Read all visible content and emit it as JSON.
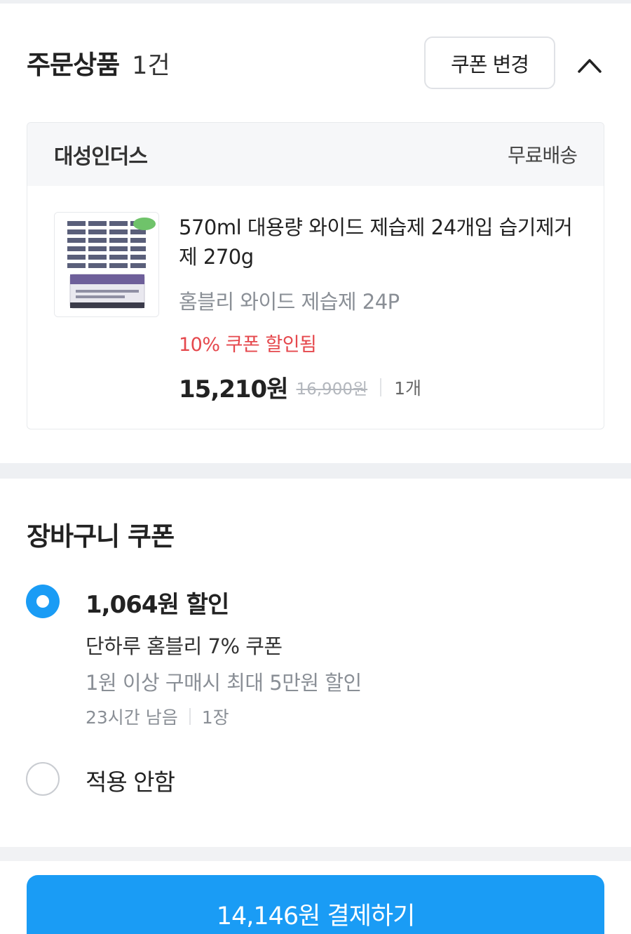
{
  "order": {
    "title": "주문상품",
    "count": "1건",
    "coupon_change_label": "쿠폰 변경",
    "collapse_icon": "chevron-up-icon"
  },
  "seller": {
    "name": "대성인더스",
    "shipping": "무료배송"
  },
  "product": {
    "name": "570ml 대용량 와이드 제습제 24개입 습기제거제 270g",
    "option": "홈블리 와이드 제습제 24P",
    "coupon_note": "10% 쿠폰 할인됨",
    "price": "15,210원",
    "original_price": "16,900원",
    "quantity": "1개",
    "thumbnail_badge": "LOHAS"
  },
  "cart_coupon": {
    "title": "장바구니 쿠폰",
    "options": [
      {
        "selected": true,
        "title": "1,064원 할인",
        "name": "단하루 홈블리 7% 쿠폰",
        "condition": "1원 이상 구매시 최대 5만원 할인",
        "time_left": "23시간 남음",
        "count": "1장"
      },
      {
        "selected": false,
        "title": "적용 안함"
      }
    ]
  },
  "checkout": {
    "pay_label": "14,146원 결제하기"
  },
  "colors": {
    "accent": "#1a9cf5",
    "discount_red": "#e5484d",
    "muted_text": "#8a8f96"
  }
}
